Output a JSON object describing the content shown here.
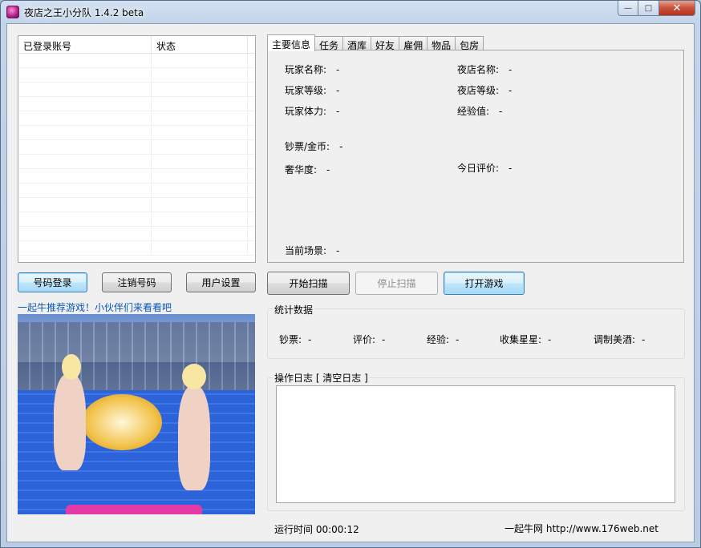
{
  "window": {
    "title": "夜店之王小分队 1.4.2 beta",
    "caption": {
      "minimize": "—",
      "maximize": "□",
      "close": "✕"
    }
  },
  "account_list": {
    "columns": [
      "已登录账号",
      "状态"
    ]
  },
  "tabs": [
    "主要信息",
    "任务",
    "酒库",
    "好友",
    "雇佣",
    "物品",
    "包房"
  ],
  "main_info": {
    "player_name_label": "玩家名称:",
    "player_name": "-",
    "club_name_label": "夜店名称:",
    "club_name": "-",
    "player_level_label": "玩家等级:",
    "player_level": "-",
    "club_level_label": "夜店等级:",
    "club_level": "-",
    "stamina_label": "玩家体力:",
    "stamina": "-",
    "exp_label": "经验值:",
    "exp": "-",
    "cash_label": "钞票/金币:",
    "cash": "-",
    "luxury_label": "奢华度:",
    "luxury": "-",
    "rating_label": "今日评价:",
    "rating": "-",
    "scene_label": "当前场景:",
    "scene": "-"
  },
  "buttons": {
    "login": "号码登录",
    "logout": "注销号码",
    "user_settings": "用户设置",
    "start_scan": "开始扫描",
    "stop_scan": "停止扫描",
    "open_game": "打开游戏"
  },
  "promo": {
    "text": "一起牛推荐游戏！小伙伴们来看看吧"
  },
  "stats": {
    "title": "统计数据",
    "cash_label": "钞票:",
    "cash": "-",
    "rating_label": "评价:",
    "rating": "-",
    "exp_label": "经验:",
    "exp": "-",
    "stars_label": "收集星星:",
    "stars": "-",
    "drinks_label": "调制美酒:",
    "drinks": "-"
  },
  "log": {
    "title": "操作日志 [ 清空日志 ]"
  },
  "footer": {
    "runtime_label": "运行时间",
    "runtime": "00:00:12",
    "site_name": "一起牛网",
    "site_url": "http://www.176web.net"
  }
}
